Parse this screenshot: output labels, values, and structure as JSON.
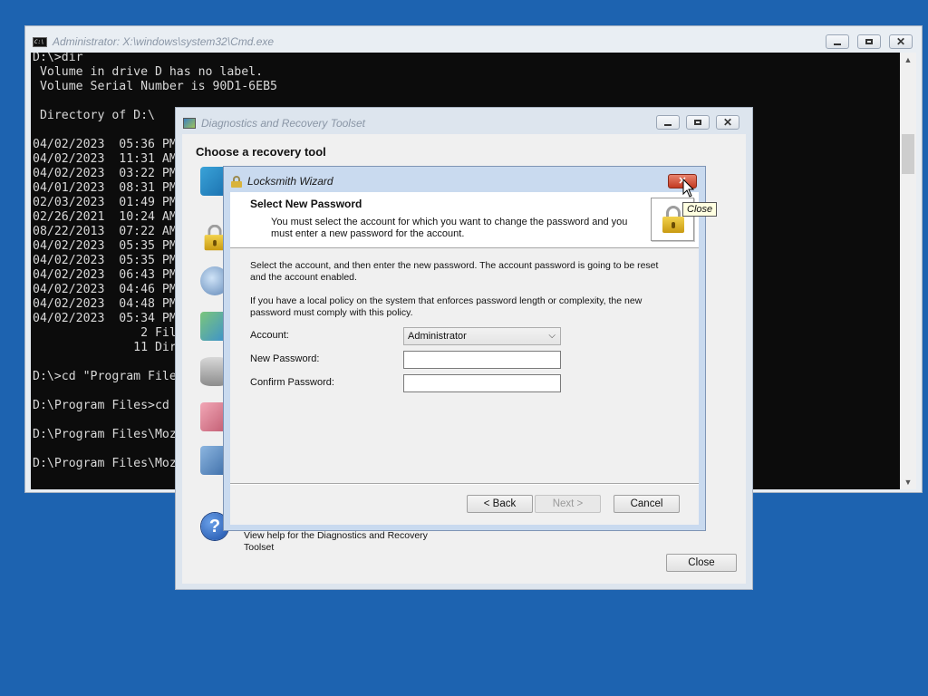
{
  "cmd": {
    "title": "Administrator: X:\\windows\\system32\\Cmd.exe",
    "lines": [
      "D:\\>dir",
      " Volume in drive D has no label.",
      " Volume Serial Number is 90D1-6EB5",
      "",
      " Directory of D:\\",
      "",
      "04/02/2023  05:36 PM",
      "04/02/2023  11:31 AM",
      "04/02/2023  03:22 PM",
      "04/01/2023  08:31 PM",
      "02/03/2023  01:49 PM",
      "02/26/2021  10:24 AM",
      "08/22/2013  07:22 AM",
      "04/02/2023  05:35 PM",
      "04/02/2023  05:35 PM",
      "04/02/2023  06:43 PM",
      "04/02/2023  04:46 PM",
      "04/02/2023  04:48 PM",
      "04/02/2023  05:34 PM",
      "               2 Fil",
      "              11 Dir",
      "",
      "D:\\>cd \"Program File",
      "",
      "D:\\Program Files>cd",
      "",
      "D:\\Program Files\\Moz",
      "",
      "D:\\Program Files\\Moz"
    ]
  },
  "dart": {
    "title": "Diagnostics and Recovery Toolset",
    "heading": "Choose a recovery tool",
    "help_text": "View help for the Diagnostics and Recovery Toolset",
    "close_label": "Close"
  },
  "wizard": {
    "title": "Locksmith Wizard",
    "header_title": "Select New Password",
    "header_desc": "You must select the account for which you want to change the password and you must enter a new password for the account.",
    "para1": "Select the account, and then enter the new password. The account password is going to be reset and the account enabled.",
    "para2": "If you have a local policy on the system that enforces password length or complexity, the new password must comply with this policy.",
    "account_label": "Account:",
    "account_value": "Administrator",
    "new_password_label": "New Password:",
    "new_password_value": "",
    "confirm_password_label": "Confirm Password:",
    "confirm_password_value": "",
    "back_label": "< Back",
    "next_label": "Next >",
    "cancel_label": "Cancel"
  },
  "tooltip": {
    "text": "Close"
  },
  "colors": {
    "desktop": "#1d63b0",
    "console_bg": "#0c0c0c",
    "close_red": "#c33a22"
  }
}
